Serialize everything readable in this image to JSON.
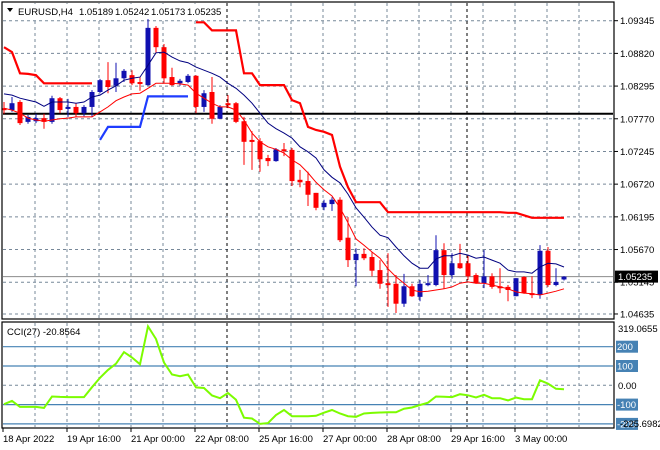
{
  "header": {
    "symbol_timeframe": "EURUSD,H4",
    "open": "1.05189",
    "high": "1.05242",
    "low": "1.05173",
    "close": "1.05235"
  },
  "price_axis": {
    "labels": [
      "1.09345",
      "1.08820",
      "1.08295",
      "1.07770",
      "1.07245",
      "1.06720",
      "1.06195",
      "1.05670",
      "1.05145",
      "1.04635"
    ],
    "current_price": "1.05235"
  },
  "cci_panel": {
    "label": "CCI(27) -20.8564",
    "max_label": "319.0655",
    "min_label": "-225.6982",
    "zero_label": "0.00",
    "level_labels": [
      "200",
      "100",
      "-100",
      "-200"
    ]
  },
  "time_axis": [
    {
      "label": "18 Apr 2022",
      "bar": 0
    },
    {
      "label": "19 Apr 16:00",
      "bar": 8
    },
    {
      "label": "21 Apr 00:00",
      "bar": 16
    },
    {
      "label": "22 Apr 08:00",
      "bar": 24
    },
    {
      "label": "25 Apr 16:00",
      "bar": 32
    },
    {
      "label": "27 Apr 00:00",
      "bar": 40
    },
    {
      "label": "28 Apr 08:00",
      "bar": 48
    },
    {
      "label": "29 Apr 16:00",
      "bar": 56
    },
    {
      "label": "3 May 00:00",
      "bar": 64
    }
  ],
  "colors": {
    "bull": "#1010b0",
    "bear": "#ff0000",
    "ma_fast": "#ff0000",
    "ma_slow": "#000080",
    "upper_band": "#ff0000",
    "lower_band": "#1e3cff",
    "cci": "#7cfc00",
    "level": "#4682b4",
    "grid": "#778899"
  },
  "chart_data": {
    "type": "candlestick",
    "title": "EURUSD,H4",
    "ylim": [
      1.04635,
      1.09345
    ],
    "grid": true,
    "ohlc": [
      [
        1.0794,
        1.0804,
        1.0785,
        1.0791
      ],
      [
        1.0791,
        1.0812,
        1.0788,
        1.0802
      ],
      [
        1.0804,
        1.0807,
        1.0767,
        1.077
      ],
      [
        1.0772,
        1.0783,
        1.0769,
        1.078
      ],
      [
        1.0773,
        1.0785,
        1.077,
        1.0778
      ],
      [
        1.0778,
        1.0785,
        1.0761,
        1.0772
      ],
      [
        1.0772,
        1.0814,
        1.0769,
        1.081
      ],
      [
        1.081,
        1.0812,
        1.0786,
        1.0791
      ],
      [
        1.0793,
        1.0809,
        1.078,
        1.0796
      ],
      [
        1.0796,
        1.0802,
        1.078,
        1.0786
      ],
      [
        1.0786,
        1.0799,
        1.0781,
        1.0796
      ],
      [
        1.0796,
        1.0823,
        1.078,
        1.082
      ],
      [
        1.082,
        1.0841,
        1.0818,
        1.0839
      ],
      [
        1.0839,
        1.0868,
        1.0818,
        1.0828
      ],
      [
        1.083,
        1.0867,
        1.082,
        1.0842
      ],
      [
        1.0842,
        1.0857,
        1.0836,
        1.0854
      ],
      [
        1.0847,
        1.0855,
        1.0831,
        1.0834
      ],
      [
        1.0836,
        1.0844,
        1.0822,
        1.0833
      ],
      [
        1.0831,
        1.0937,
        1.083,
        1.0923
      ],
      [
        1.0923,
        1.0926,
        1.0883,
        1.0892
      ],
      [
        1.0892,
        1.0897,
        1.0834,
        1.0842
      ],
      [
        1.0844,
        1.0859,
        1.083,
        1.0831
      ],
      [
        1.0834,
        1.0841,
        1.083,
        1.0838
      ],
      [
        1.0836,
        1.0849,
        1.0834,
        1.0846
      ],
      [
        1.0846,
        1.0847,
        1.0786,
        1.0796
      ],
      [
        1.0796,
        1.0823,
        1.0788,
        1.0818
      ],
      [
        1.082,
        1.0844,
        1.0769,
        1.0777
      ],
      [
        1.0777,
        1.0799,
        1.0777,
        1.0796
      ],
      [
        1.0802,
        1.0815,
        1.0794,
        1.0799
      ],
      [
        1.0802,
        1.0804,
        1.077,
        1.0772
      ],
      [
        1.0773,
        1.078,
        1.0703,
        1.074
      ],
      [
        1.0743,
        1.0757,
        1.0695,
        1.074
      ],
      [
        1.0741,
        1.0746,
        1.0692,
        1.0712
      ],
      [
        1.0714,
        1.0719,
        1.0701,
        1.0709
      ],
      [
        1.0709,
        1.073,
        1.0708,
        1.0728
      ],
      [
        1.0728,
        1.0738,
        1.0717,
        1.0725
      ],
      [
        1.0727,
        1.073,
        1.0669,
        1.0677
      ],
      [
        1.0679,
        1.0695,
        1.0667,
        1.0675
      ],
      [
        1.0677,
        1.0692,
        1.0637,
        1.0655
      ],
      [
        1.0658,
        1.0658,
        1.063,
        1.0634
      ],
      [
        1.0635,
        1.0647,
        1.063,
        1.0642
      ],
      [
        1.064,
        1.0651,
        1.0629,
        1.0647
      ],
      [
        1.0647,
        1.0651,
        1.0579,
        1.0582
      ],
      [
        1.0586,
        1.0619,
        1.0539,
        1.055
      ],
      [
        1.055,
        1.0569,
        1.0508,
        1.056
      ],
      [
        1.056,
        1.0569,
        1.055,
        1.0553
      ],
      [
        1.0555,
        1.0563,
        1.0524,
        1.0533
      ],
      [
        1.0534,
        1.055,
        1.0504,
        1.0512
      ],
      [
        1.0513,
        1.0561,
        1.0475,
        1.051
      ],
      [
        1.0512,
        1.0526,
        1.0465,
        1.048
      ],
      [
        1.048,
        1.0528,
        1.0475,
        1.0508
      ],
      [
        1.0508,
        1.0512,
        1.0491,
        1.0492
      ],
      [
        1.0491,
        1.0518,
        1.0484,
        1.0512
      ],
      [
        1.051,
        1.0526,
        1.0508,
        1.0513
      ],
      [
        1.051,
        1.059,
        1.0508,
        1.0566
      ],
      [
        1.0566,
        1.0577,
        1.0504,
        1.0526
      ],
      [
        1.0526,
        1.0561,
        1.052,
        1.0545
      ],
      [
        1.0545,
        1.0576,
        1.0536,
        1.0537
      ],
      [
        1.0545,
        1.0557,
        1.0518,
        1.0524
      ],
      [
        1.0526,
        1.0529,
        1.0512,
        1.0513
      ],
      [
        1.0513,
        1.0566,
        1.0505,
        1.0524
      ],
      [
        1.0524,
        1.0529,
        1.0504,
        1.0507
      ],
      [
        1.0508,
        1.0537,
        1.0497,
        1.0507
      ],
      [
        1.0507,
        1.051,
        1.0484,
        1.0502
      ],
      [
        1.0492,
        1.0521,
        1.0492,
        1.0521
      ],
      [
        1.0523,
        1.0524,
        1.0496,
        1.0497
      ],
      [
        1.0497,
        1.0524,
        1.0489,
        1.0494
      ],
      [
        1.0494,
        1.0574,
        1.0488,
        1.0565
      ],
      [
        1.0565,
        1.0571,
        1.0507,
        1.051
      ],
      [
        1.051,
        1.0537,
        1.0508,
        1.0515
      ],
      [
        1.05189,
        1.05242,
        1.05173,
        1.05235
      ]
    ],
    "series": [
      {
        "name": "ma_fast",
        "values": [
          1.0794,
          1.0791,
          1.0786,
          1.0778,
          1.0775,
          1.0773,
          1.0775,
          1.0777,
          1.0778,
          1.078,
          1.078,
          1.078,
          1.0788,
          1.0796,
          1.0806,
          1.0812,
          1.0817,
          1.0818,
          1.0826,
          1.0834,
          1.0834,
          1.0834,
          1.0833,
          1.0831,
          1.0818,
          1.081,
          1.0802,
          1.0796,
          1.0796,
          1.0791,
          1.0775,
          1.0754,
          1.074,
          1.0732,
          1.0728,
          1.0722,
          1.0711,
          1.0703,
          1.069,
          1.0675,
          1.0663,
          1.0653,
          1.0634,
          1.061,
          1.0584,
          1.0574,
          1.0563,
          1.0553,
          1.0536,
          1.0523,
          1.0513,
          1.0502,
          1.0499,
          1.05,
          1.0502,
          1.0504,
          1.0507,
          1.0513,
          1.0515,
          1.0513,
          1.0513,
          1.051,
          1.0507,
          1.0504,
          1.0499,
          1.0497,
          1.0496,
          1.0494,
          1.0497,
          1.05,
          1.0504
        ]
      },
      {
        "name": "ma_slow",
        "values": [
          1.0817,
          1.0815,
          1.081,
          1.0807,
          1.0804,
          1.0797,
          1.0804,
          1.0804,
          1.0804,
          1.0802,
          1.0804,
          1.0812,
          1.0815,
          1.0823,
          1.083,
          1.0839,
          1.0842,
          1.0844,
          1.0863,
          1.0883,
          1.0884,
          1.0876,
          1.087,
          1.0867,
          1.086,
          1.0855,
          1.085,
          1.0844,
          1.0834,
          1.0826,
          1.0815,
          1.0802,
          1.0786,
          1.077,
          1.0761,
          1.0754,
          1.0746,
          1.0732,
          1.0724,
          1.0714,
          1.0695,
          1.0683,
          1.0674,
          1.0656,
          1.0634,
          1.0619,
          1.0603,
          1.059,
          1.0586,
          1.0571,
          1.0557,
          1.0545,
          1.0537,
          1.0537,
          1.0552,
          1.0557,
          1.0557,
          1.0561,
          1.0558,
          1.0553,
          1.0555,
          1.055,
          1.0545,
          1.0534,
          1.0531,
          1.0531,
          1.0529,
          1.0539,
          1.0545,
          1.0544,
          1.0539
        ]
      },
      {
        "name": "upper_band",
        "values": [
          1.0892,
          1.0884,
          1.085,
          1.0849,
          1.0847,
          1.0834,
          1.0834,
          1.0834,
          1.0834,
          1.0834,
          1.0834,
          1.0834,
          null,
          null,
          null,
          null,
          null,
          null,
          null,
          null,
          null,
          null,
          null,
          null,
          1.0932,
          1.0932,
          1.0919,
          1.0919,
          1.0919,
          1.0919,
          1.085,
          1.085,
          1.0831,
          1.0831,
          1.0831,
          1.0831,
          1.0807,
          1.0802,
          1.0764,
          1.0759,
          1.0756,
          1.0751,
          1.07,
          1.0667,
          1.0643,
          1.0643,
          1.0643,
          1.0643,
          1.0627,
          1.0627,
          1.0627,
          1.0627,
          1.0627,
          1.0627,
          1.0627,
          1.0627,
          1.0627,
          1.0627,
          1.0627,
          1.0627,
          1.0627,
          1.0627,
          1.0627,
          1.0626,
          1.0626,
          1.0622,
          1.0618,
          1.0618,
          1.0618,
          1.0618,
          1.0618
        ]
      },
      {
        "name": "lower_band",
        "values": [
          null,
          null,
          null,
          null,
          null,
          null,
          null,
          null,
          null,
          null,
          null,
          null,
          1.0743,
          1.0764,
          1.0764,
          1.0764,
          1.0764,
          1.0764,
          1.0813,
          1.0813,
          1.0813,
          1.0813,
          1.0813,
          1.0813,
          null,
          null,
          null,
          null,
          null,
          null,
          null,
          null,
          null,
          null,
          null,
          null,
          null,
          null,
          null,
          null,
          null,
          null,
          null,
          null,
          null,
          null,
          null,
          null,
          null,
          null,
          null,
          null,
          null,
          null,
          null,
          null,
          null,
          null,
          null,
          null,
          null,
          null,
          null,
          null,
          null,
          null,
          null,
          null,
          null,
          null,
          null
        ]
      }
    ],
    "horizontal_line": 1.0785,
    "vertical_markers_bar": [
      28,
      58
    ],
    "cci": {
      "name": "CCI(27)",
      "ylim": [
        -225.6982,
        319.0655
      ],
      "levels": [
        200,
        100,
        0,
        -100,
        -200
      ],
      "values": [
        -98,
        -81,
        -112,
        -112,
        -112,
        -117,
        -58,
        -60,
        -61,
        -61,
        -61,
        -10,
        39,
        80,
        112,
        172,
        144,
        109,
        305,
        240,
        118,
        56,
        47,
        56,
        -11,
        -14,
        -53,
        -67,
        -40,
        -75,
        -168,
        -172,
        -200,
        -196,
        -154,
        -128,
        -160,
        -160,
        -160,
        -158,
        -142,
        -128,
        -146,
        -160,
        -163,
        -146,
        -143,
        -141,
        -140,
        -140,
        -121,
        -115,
        -102,
        -90,
        -58,
        -59,
        -61,
        -46,
        -52,
        -63,
        -49,
        -67,
        -67,
        -78,
        -63,
        -72,
        -72,
        26,
        9,
        -18,
        -20.8564
      ]
    }
  }
}
